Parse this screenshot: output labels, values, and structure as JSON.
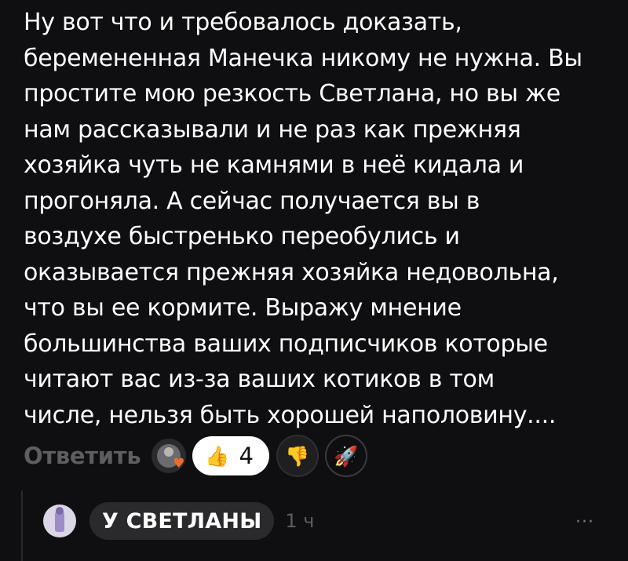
{
  "comment": {
    "text": "Ну вот что и требовалось доказать,\nберемененная Манечка никому не нужна. Вы\nпростите мою резкость Светлана, но вы же\nнам рассказывали и не раз как прежняя\nхозяйка чуть не камнями в неё кидала и\nпрогоняла. А сейчас получается вы в\nвоздухе быстренько переобулись и\nоказывается прежняя хозяйка недовольна,\nчто вы ее кормите. Выражу мнение\nбольшинства ваших подписчиков которые\nчитают вас из-за ваших котиков в том\nчисле, нельзя быть хорошей наполовину...."
  },
  "actions": {
    "reply_label": "Ответить",
    "reactor_heart": "♥",
    "reactions": [
      {
        "emoji": "👍",
        "icon": "thumbs-up-icon",
        "count": "4"
      },
      {
        "emoji": "👎",
        "icon": "thumbs-down-icon"
      },
      {
        "emoji": "🚀",
        "icon": "rocket-icon"
      }
    ]
  },
  "reply": {
    "author": "У СВЕТЛАНЫ",
    "time": "1 ч",
    "more_label": "···"
  }
}
